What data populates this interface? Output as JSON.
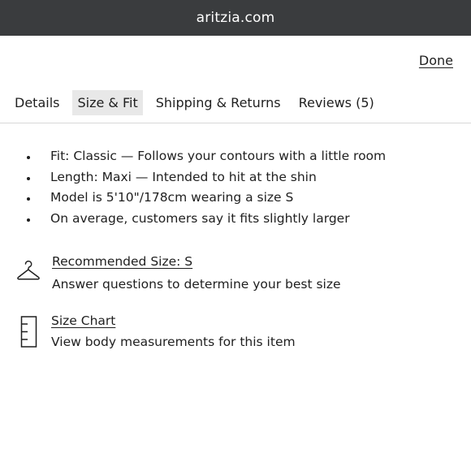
{
  "browser": {
    "url": "aritzia.com"
  },
  "header": {
    "done_label": "Done"
  },
  "tabs": [
    {
      "label": "Details",
      "active": false
    },
    {
      "label": "Size & Fit",
      "active": true
    },
    {
      "label": "Shipping & Returns",
      "active": false
    },
    {
      "label": "Reviews (5)",
      "active": false
    }
  ],
  "fit_info": [
    "Fit: Classic — Follows your contours with a little room",
    "Length: Maxi — Intended to hit at the shin",
    "Model is 5'10\"/178cm wearing a size S",
    "On average, customers say it fits slightly larger"
  ],
  "recommended_size": {
    "title": "Recommended Size: S",
    "description": "Answer questions to determine your best size",
    "icon": "hanger-icon"
  },
  "size_chart": {
    "title": "Size Chart",
    "description": "View body measurements for this item",
    "icon": "ruler-icon"
  },
  "colors": {
    "url_bar": "#3a3c3e",
    "active_tab": "#e8e8e8",
    "text": "#1f1f1f",
    "divider": "#d8d8d8"
  }
}
